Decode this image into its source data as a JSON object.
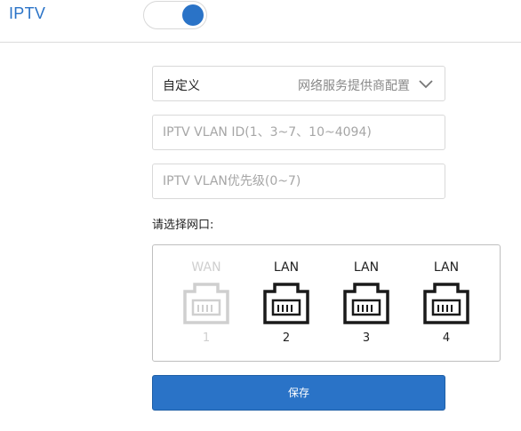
{
  "header": {
    "title": "IPTV",
    "toggle_on": true
  },
  "form": {
    "mode_select": {
      "value": "自定义",
      "hint": "网络服务提供商配置"
    },
    "vlan_id": {
      "value": "",
      "placeholder": "IPTV VLAN ID(1、3~7、10~4094)"
    },
    "vlan_priority": {
      "value": "",
      "placeholder": "IPTV VLAN优先级(0~7)"
    },
    "port_label": "请选择网口:",
    "ports": [
      {
        "name": "WAN",
        "number": "1",
        "enabled": false
      },
      {
        "name": "LAN",
        "number": "2",
        "enabled": true
      },
      {
        "name": "LAN",
        "number": "3",
        "enabled": true
      },
      {
        "name": "LAN",
        "number": "4",
        "enabled": true
      }
    ],
    "save_label": "保存"
  },
  "colors": {
    "accent": "#2a73c7",
    "disabled": "#cfcfcf",
    "border": "#d9d9d9"
  },
  "icons": {
    "dropdown": "chevron-down-icon",
    "port": "ethernet-port-icon"
  }
}
